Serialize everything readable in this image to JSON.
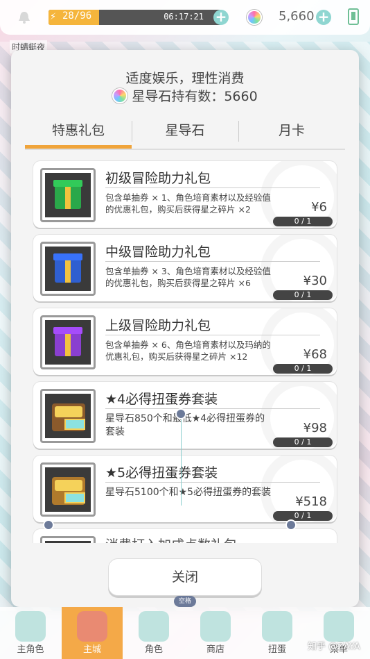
{
  "background": {
    "label": "时蜻蜓夜"
  },
  "topbar": {
    "stamina_text": "28/96",
    "stamina_fraction": 0.29,
    "timer": "06:17:21",
    "gem_count": "5,660"
  },
  "modal": {
    "title": "适度娱乐，理性消费",
    "holdings_label": "星导石持有数：5660",
    "tabs": [
      {
        "label": "特惠礼包",
        "active": true
      },
      {
        "label": "星导石",
        "active": false
      },
      {
        "label": "月卡",
        "active": false
      }
    ],
    "items": [
      {
        "title": "初级冒险助力礼包",
        "desc": "包含单抽券 × 1、角色培育素材以及经验值的优惠礼包，购买后获得星之碎片 ×2",
        "price": "¥6",
        "limit": "0 / 1",
        "gift_color": "#2aa84a",
        "icon": "green-gift-icon"
      },
      {
        "title": "中级冒险助力礼包",
        "desc": "包含单抽券 × 3、角色培育素材以及经验值的优惠礼包，购买后获得星之碎片 ×6",
        "price": "¥30",
        "limit": "0 / 1",
        "gift_color": "#2f5fd0",
        "icon": "blue-gift-icon"
      },
      {
        "title": "上级冒险助力礼包",
        "desc": "包含单抽券 × 6、角色培育素材以及玛纳的优惠礼包，购买后获得星之碎片 ×12",
        "price": "¥68",
        "limit": "0 / 1",
        "gift_color": "#8a3fd0",
        "icon": "purple-gift-icon"
      },
      {
        "title": "★4必得扭蛋券套装",
        "desc": "星导石850个和最低★4必得扭蛋券的套装",
        "price": "¥98",
        "limit": "0 / 1",
        "icon": "treasure-chest-icon"
      },
      {
        "title": "★5必得扭蛋券套装",
        "desc": "星导石5100个和★5必得扭蛋券的套装",
        "price": "¥518",
        "limit": "0 / 1",
        "icon": "treasure-chest-icon"
      },
      {
        "title": "消费打入加成点数礼包",
        "partial": true
      }
    ],
    "close_label": "关闭",
    "space_hint": "空格"
  },
  "bottom_nav": [
    {
      "label": "主角色",
      "active": false
    },
    {
      "label": "主城",
      "active": true
    },
    {
      "label": "角色",
      "active": false
    },
    {
      "label": "商店",
      "active": false
    },
    {
      "label": "扭蛋",
      "active": false
    },
    {
      "label": "菜单",
      "active": false
    }
  ],
  "watermark": "知乎 @ZAYA",
  "colors": {
    "accent_orange": "#f0a43a",
    "teal": "#8fd6d1",
    "dark_badge": "#444444"
  }
}
